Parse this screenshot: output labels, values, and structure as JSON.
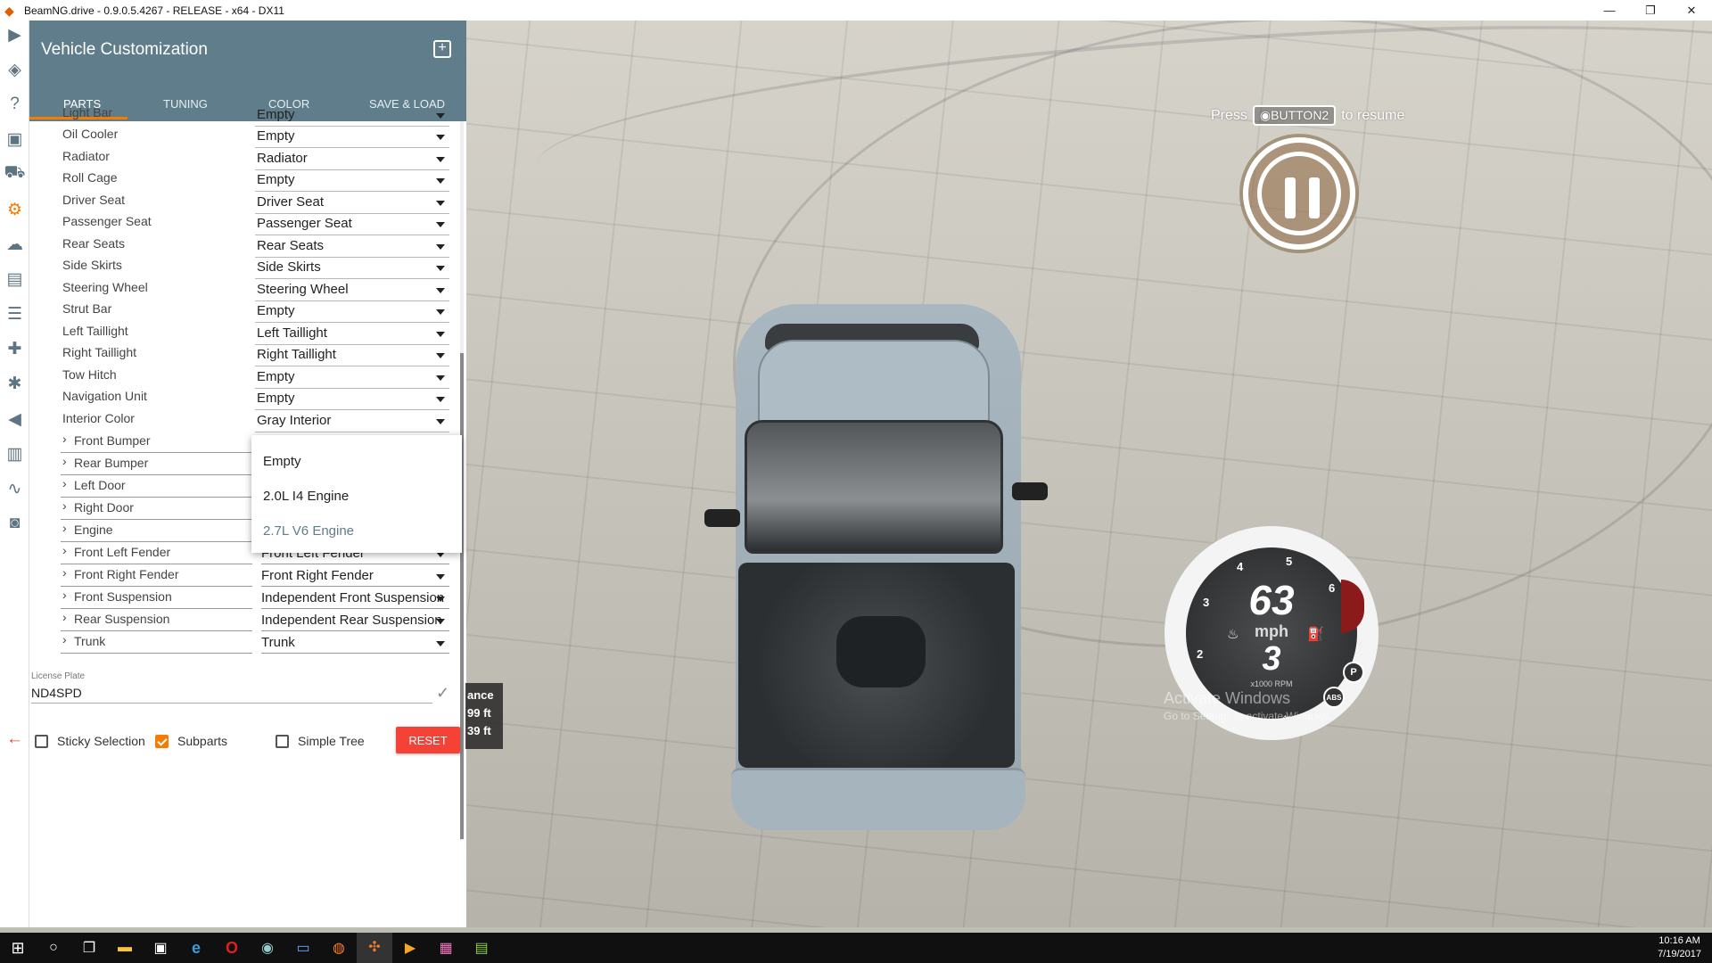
{
  "window": {
    "title": "BeamNG.drive - 0.9.0.5.4267 - RELEASE - x64 - DX11",
    "minimize": "—",
    "maximize": "❐",
    "close": "✕"
  },
  "rail_icons": [
    "play-icon",
    "layers-icon",
    "help-icon",
    "film-icon",
    "car-icon",
    "gear-icon",
    "cloud-icon",
    "layout-icon",
    "sliders-icon",
    "gamepad-icon",
    "bug-icon",
    "volume-icon",
    "chart-icon",
    "route-icon",
    "camera-icon",
    "back-arrow-icon"
  ],
  "panel": {
    "title": "Vehicle Customization",
    "tabs": [
      "PARTS",
      "TUNING",
      "COLOR",
      "SAVE & LOAD"
    ],
    "active_tab": "PARTS",
    "parts": [
      {
        "label": "Light Bar",
        "value": "Empty"
      },
      {
        "label": "Oil Cooler",
        "value": "Empty"
      },
      {
        "label": "Radiator",
        "value": "Radiator"
      },
      {
        "label": "Roll Cage",
        "value": "Empty"
      },
      {
        "label": "Driver Seat",
        "value": "Driver Seat"
      },
      {
        "label": "Passenger Seat",
        "value": "Passenger Seat"
      },
      {
        "label": "Rear Seats",
        "value": "Rear Seats"
      },
      {
        "label": "Side Skirts",
        "value": "Side Skirts"
      },
      {
        "label": "Steering Wheel",
        "value": "Steering Wheel"
      },
      {
        "label": "Strut Bar",
        "value": "Empty"
      },
      {
        "label": "Left Taillight",
        "value": "Left Taillight"
      },
      {
        "label": "Right Taillight",
        "value": "Right Taillight"
      },
      {
        "label": "Tow Hitch",
        "value": "Empty"
      },
      {
        "label": "Navigation Unit",
        "value": "Empty"
      },
      {
        "label": "Interior Color",
        "value": "Gray Interior"
      }
    ],
    "subparts": [
      {
        "label": "Front Bumper",
        "value": ""
      },
      {
        "label": "Rear Bumper",
        "value": ""
      },
      {
        "label": "Left Door",
        "value": ""
      },
      {
        "label": "Right Door",
        "value": ""
      },
      {
        "label": "Engine",
        "value": ""
      },
      {
        "label": "Front Left Fender",
        "value": "Front Left Fender"
      },
      {
        "label": "Front Right Fender",
        "value": "Front Right Fender"
      },
      {
        "label": "Front Suspension",
        "value": "Independent Front Suspension"
      },
      {
        "label": "Rear Suspension",
        "value": "Independent Rear Suspension"
      },
      {
        "label": "Trunk",
        "value": "Trunk"
      }
    ],
    "dropdown": {
      "options": [
        "Empty",
        "2.0L I4 Engine",
        "2.7L V6 Engine"
      ],
      "selected": "2.7L V6 Engine"
    },
    "license_plate": {
      "label": "License Plate",
      "value": "ND4SPD"
    },
    "options": {
      "sticky_selection": {
        "label": "Sticky Selection",
        "checked": false
      },
      "subparts": {
        "label": "Subparts",
        "checked": true
      },
      "simple_tree": {
        "label": "Simple Tree",
        "checked": false
      }
    },
    "reset_label": "RESET",
    "accent": "#f57c00",
    "header_color": "#607d8b"
  },
  "distance": {
    "line1": "ance",
    "line2": "99 ft",
    "line3": "39 ft"
  },
  "pause": {
    "press": "Press",
    "button": "BUTTON2",
    "to_resume": "to resume"
  },
  "gauge": {
    "speed": "63",
    "unit": "mph",
    "gear": "3",
    "rpm_label": "x1000 RPM",
    "ticks": [
      "2",
      "3",
      "4",
      "5",
      "6"
    ],
    "abs": "ABS",
    "park": "P"
  },
  "watermark": {
    "line1": "Activate Windows",
    "line2": "Go to Settings to activate Windows."
  },
  "taskbar": {
    "time": "10:16 AM",
    "date": "7/19/2017",
    "apps": [
      "windows-start-icon",
      "cortana-icon",
      "task-view-icon",
      "file-explorer-icon",
      "store-icon",
      "edge-icon",
      "opera-icon",
      "steam-icon",
      "monitor-app-icon",
      "blender-icon",
      "beamng-icon",
      "media-app-icon",
      "paint-app-icon",
      "notepad-app-icon"
    ]
  }
}
